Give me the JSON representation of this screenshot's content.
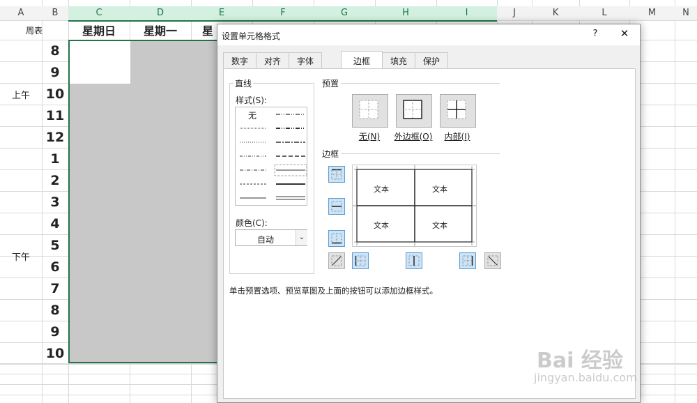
{
  "columns": [
    "A",
    "B",
    "C",
    "D",
    "E",
    "F",
    "G",
    "H",
    "I",
    "J",
    "K",
    "L",
    "M",
    "N"
  ],
  "sheet": {
    "corner_label": "周表",
    "day_headers": [
      "星期日",
      "星期一",
      "星"
    ],
    "morning_label": "上午",
    "afternoon_label": "下午",
    "hours": [
      "8",
      "9",
      "10",
      "11",
      "12",
      "1",
      "2",
      "3",
      "4",
      "5",
      "6",
      "7",
      "8",
      "9",
      "10"
    ]
  },
  "dialog": {
    "title": "设置单元格格式",
    "help": "?",
    "close": "✕",
    "tabs": [
      "数字",
      "对齐",
      "字体",
      "边框",
      "填充",
      "保护"
    ],
    "active_tab": "边框",
    "line_group": "直线",
    "style_label": "样式(S):",
    "none_style": "无",
    "color_label": "颜色(C):",
    "color_value": "自动",
    "preset_group": "预置",
    "presets": [
      "无(N)",
      "外边框(O)",
      "内部(I)"
    ],
    "border_group": "边框",
    "preview_text": "文本",
    "hint": "单击预置选项、预览草图及上面的按钮可以添加边框样式。"
  },
  "watermark": {
    "logo": "Bai 经验",
    "url": "jingyan.baidu.com"
  },
  "colors": {
    "selected_green": "#217346",
    "fill_gray": "#c8c8c8",
    "button_blue": "#cce4f7"
  }
}
